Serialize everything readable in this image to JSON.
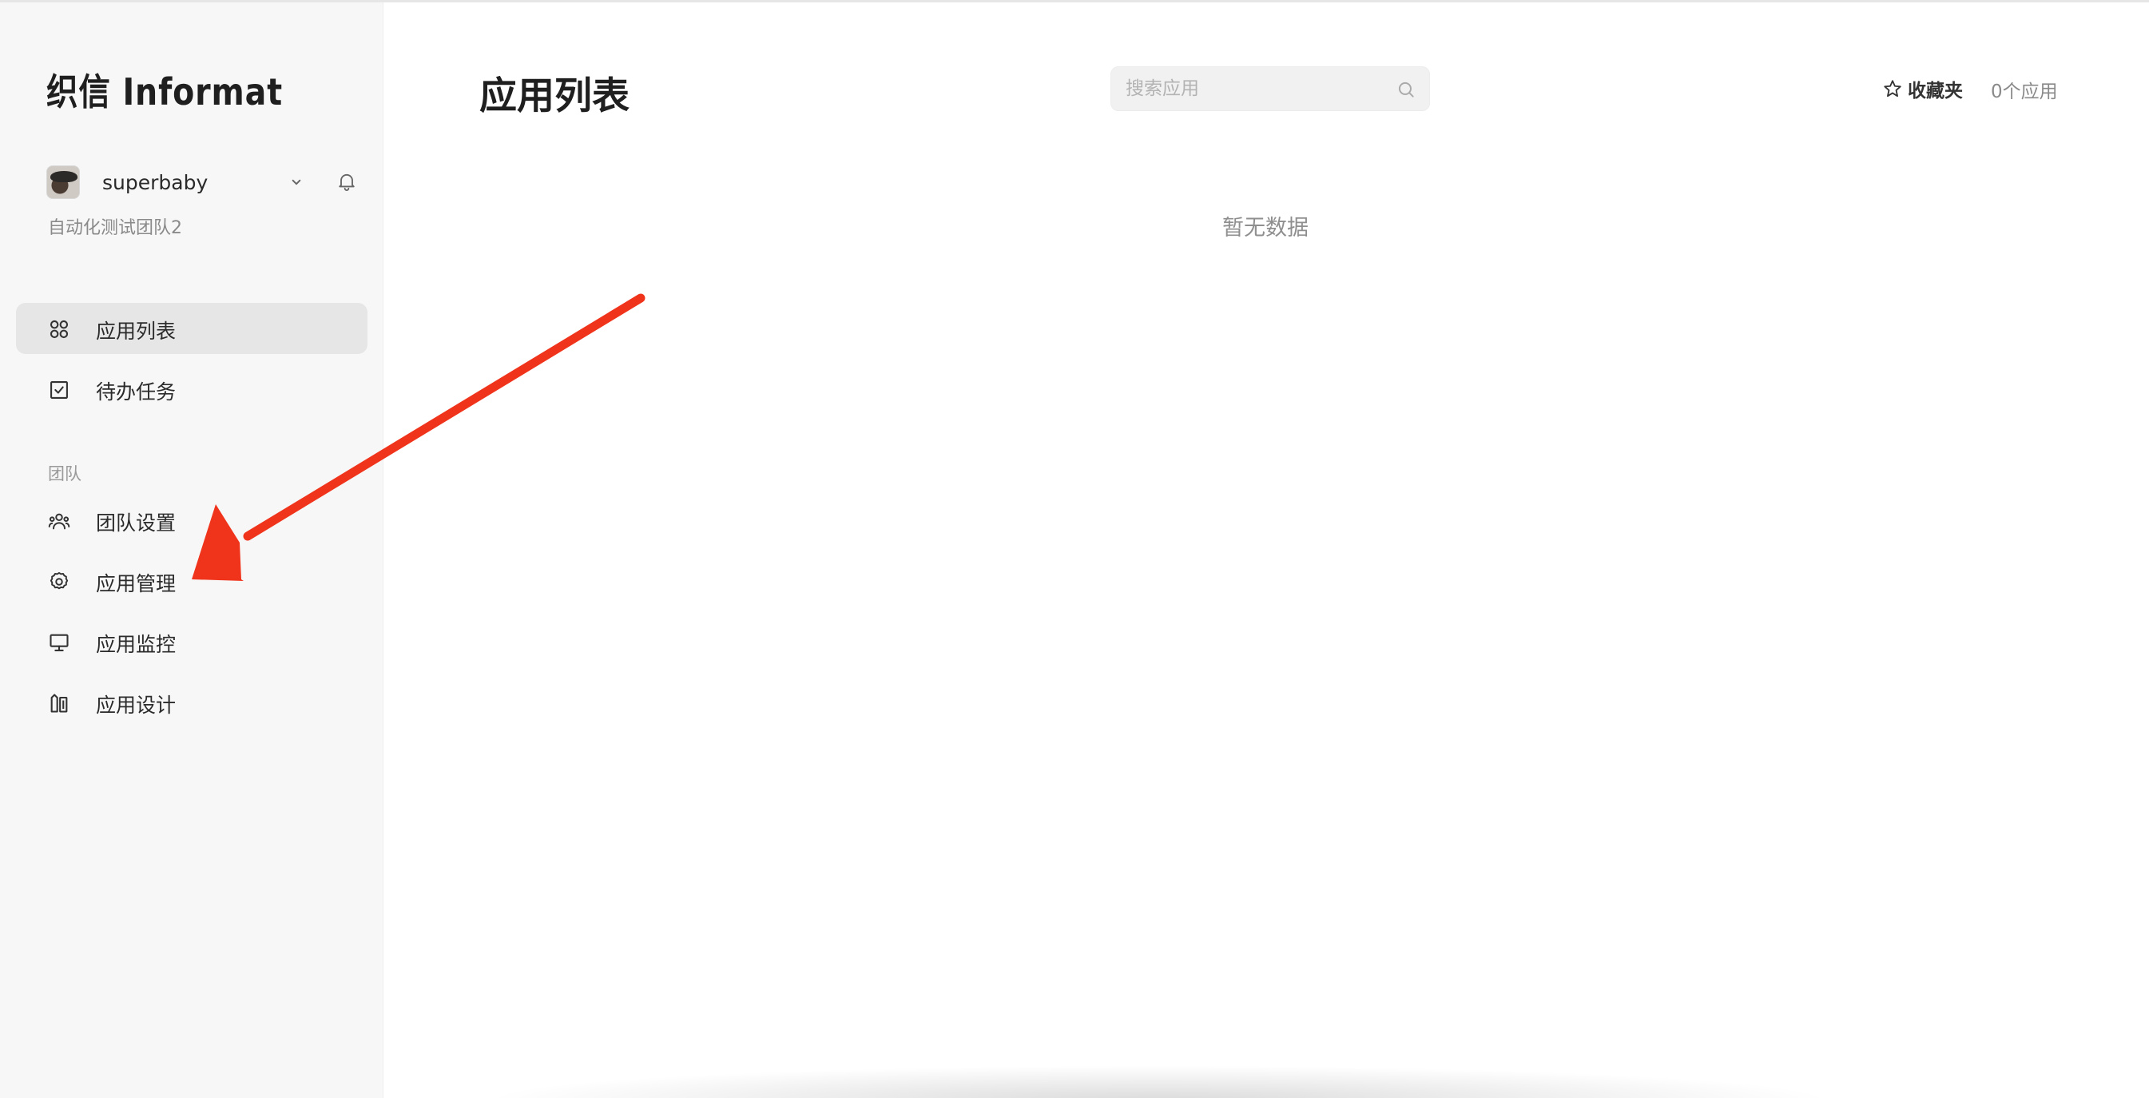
{
  "sidebar": {
    "logo": "织信 Informat",
    "user": {
      "name": "superbaby",
      "team": "自动化测试团队2"
    },
    "nav": [
      {
        "label": "应用列表",
        "icon": "grid-icon",
        "active": true
      },
      {
        "label": "待办任务",
        "icon": "checkbox-icon",
        "active": false
      }
    ],
    "section_title": "团队",
    "team_nav": [
      {
        "label": "团队设置",
        "icon": "team-icon"
      },
      {
        "label": "应用管理",
        "icon": "gear-icon"
      },
      {
        "label": "应用监控",
        "icon": "monitor-icon"
      },
      {
        "label": "应用设计",
        "icon": "design-icon"
      }
    ]
  },
  "main": {
    "title": "应用列表",
    "search_placeholder": "搜索应用",
    "favorites_label": "收藏夹",
    "app_count": "0个应用",
    "empty_text": "暂无数据"
  },
  "colors": {
    "sidebar_bg": "#f7f7f7",
    "active_item_bg": "#e6e6e6",
    "annotation_arrow": "#f0341c"
  }
}
